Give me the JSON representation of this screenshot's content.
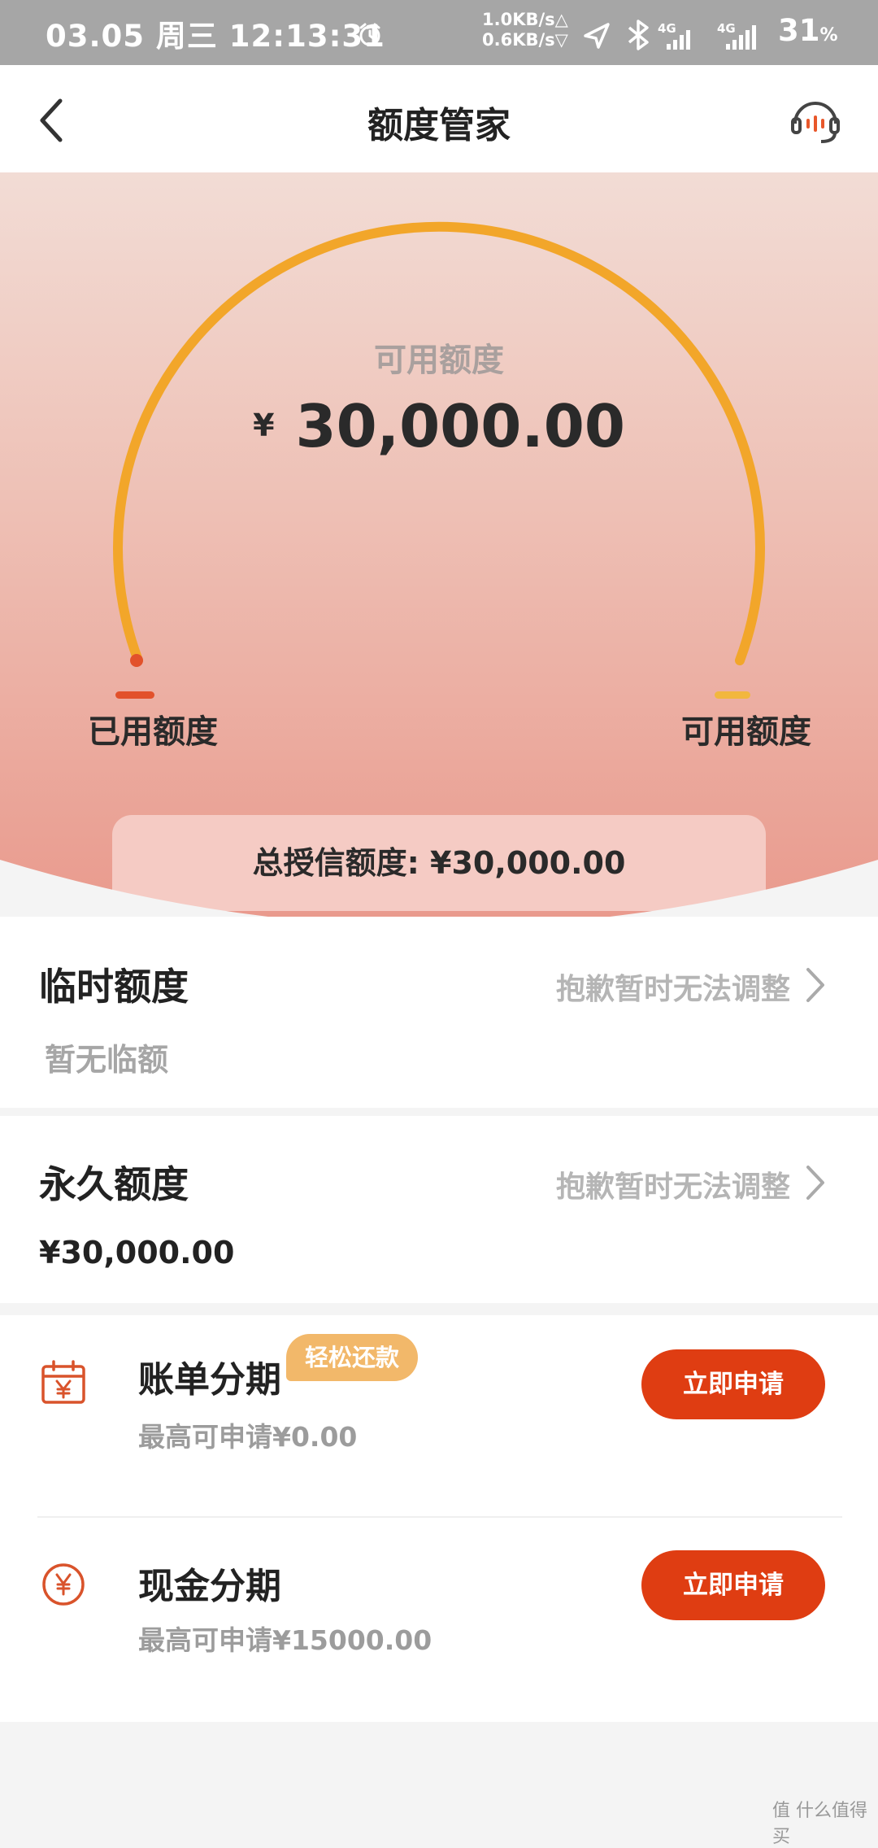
{
  "status_bar": {
    "date_time": "03.05 周三 12:13:31",
    "upload_speed": "1.0KB/s△",
    "download_speed": "0.6KB/s▽",
    "network_1": "4G",
    "network_2": "4G",
    "battery": "31",
    "battery_unit": "%"
  },
  "header": {
    "title": "额度管家",
    "back_icon": "chevron-left-icon",
    "service_icon": "headset-icon"
  },
  "gauge": {
    "center_label": "可用额度",
    "currency": "¥",
    "amount": "30,000.00",
    "used_legend": "已用额度",
    "available_legend": "可用额度",
    "used_fraction": 0.0,
    "available_fraction": 1.0,
    "used_color": "#e2512b",
    "available_color": "#f2a62a"
  },
  "total_credit": "总授信额度: ¥30,000.00",
  "temp_limit": {
    "title": "临时额度",
    "status": "抱歉暂时无法调整",
    "value": "暂无临额"
  },
  "permanent_limit": {
    "title": "永久额度",
    "status": "抱歉暂时无法调整",
    "value": "¥30,000.00"
  },
  "installments": [
    {
      "icon": "calendar-yen-icon",
      "title": "账单分期",
      "badge": "轻松还款",
      "subtitle": "最高可申请¥0.00",
      "button": "立即申请"
    },
    {
      "icon": "yen-circle-icon",
      "title": "现金分期",
      "subtitle": "最高可申请¥15000.00",
      "button": "立即申请"
    }
  ],
  "watermark": "值 什么值得买",
  "colors": {
    "accent": "#df3d12",
    "gauge_arc": "#f2a62a",
    "badge": "#f2b86a"
  }
}
